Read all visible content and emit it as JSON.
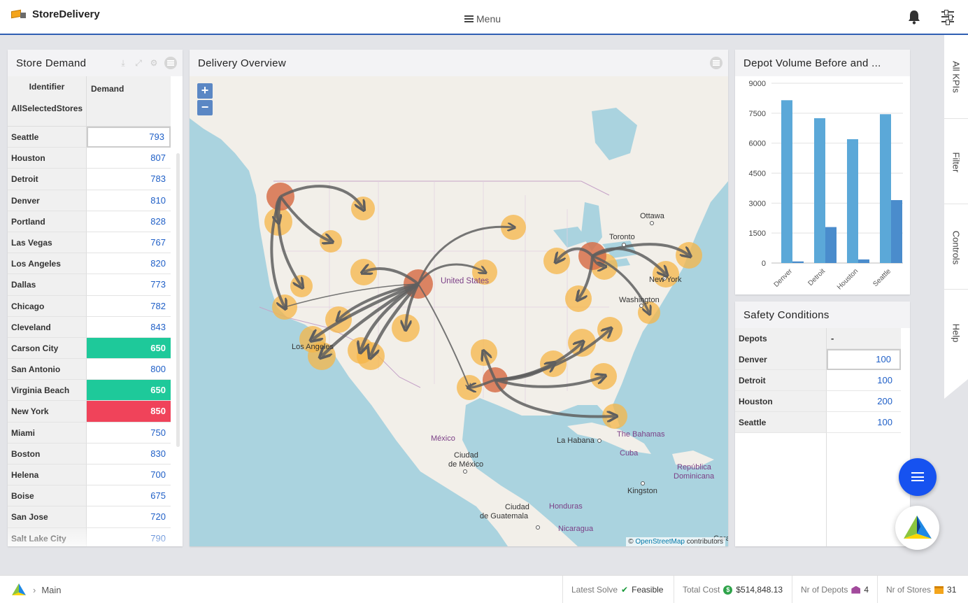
{
  "app": {
    "title": "StoreDelivery",
    "menu_label": "Menu"
  },
  "store_demand": {
    "title": "Store Demand",
    "header_identifier": "Identifier",
    "header_all": "AllSelectedStores",
    "header_demand": "Demand",
    "rows": [
      {
        "store": "Seattle",
        "demand": "793"
      },
      {
        "store": "Houston",
        "demand": "807"
      },
      {
        "store": "Detroit",
        "demand": "783"
      },
      {
        "store": "Denver",
        "demand": "810"
      },
      {
        "store": "Portland",
        "demand": "828"
      },
      {
        "store": "Las Vegas",
        "demand": "767"
      },
      {
        "store": "Los Angeles",
        "demand": "820"
      },
      {
        "store": "Dallas",
        "demand": "773"
      },
      {
        "store": "Chicago",
        "demand": "782"
      },
      {
        "store": "Cleveland",
        "demand": "843"
      },
      {
        "store": "Carson City",
        "demand": "650"
      },
      {
        "store": "San Antonio",
        "demand": "800"
      },
      {
        "store": "Virginia Beach",
        "demand": "650"
      },
      {
        "store": "New York",
        "demand": "850"
      },
      {
        "store": "Miami",
        "demand": "750"
      },
      {
        "store": "Boston",
        "demand": "830"
      },
      {
        "store": "Helena",
        "demand": "700"
      },
      {
        "store": "Boise",
        "demand": "675"
      },
      {
        "store": "San Jose",
        "demand": "720"
      },
      {
        "store": "Salt Lake City",
        "demand": "790"
      }
    ]
  },
  "delivery_overview": {
    "title": "Delivery Overview",
    "zoom_in": "+",
    "zoom_out": "−",
    "labels": {
      "ottawa": "Ottawa",
      "toronto": "Toronto",
      "united_states": "United States",
      "new_york": "New York",
      "washington": "Washington",
      "los_angeles": "Los Angeles",
      "mexico": "México",
      "ciudad_mexico_1": "Ciudad",
      "ciudad_mexico_2": "de México",
      "la_habana": "La Habana",
      "bahamas": "The Bahamas",
      "cuba": "Cuba",
      "rep_dom_1": "República",
      "rep_dom_2": "Dominicana",
      "kingston": "Kingston",
      "ciudad_guatemala_1": "Ciudad",
      "ciudad_guatemala_2": "de Guatemala",
      "honduras": "Honduras",
      "nicaragua": "Nicaragua",
      "caracas": "Carac"
    },
    "attribution_prefix": "©",
    "attribution_link": "OpenStreetMap",
    "attribution_suffix": "contributors"
  },
  "depot_volume": {
    "title": "Depot Volume Before and ...",
    "y_ticks": [
      "9000",
      "7500",
      "6000",
      "4500",
      "3000",
      "1500",
      "0"
    ]
  },
  "chart_data": {
    "type": "bar",
    "title": "Depot Volume Before and ...",
    "categories": [
      "Denver",
      "Detroit",
      "Houston",
      "Seattle"
    ],
    "series": [
      {
        "values": [
          8150,
          7250,
          6200,
          7450
        ],
        "color": "#5ba8d8"
      },
      {
        "values": [
          80,
          1800,
          180,
          3150
        ],
        "color": "#4a8ccc"
      }
    ],
    "ylim": [
      0,
      9000
    ],
    "yticks": [
      0,
      1500,
      3000,
      4500,
      6000,
      7500,
      9000
    ],
    "grid": true
  },
  "safety_conditions": {
    "title": "Safety Conditions",
    "header_depots": "Depots",
    "header_value": "-",
    "rows": [
      {
        "depot": "Denver",
        "value": "100"
      },
      {
        "depot": "Detroit",
        "value": "100"
      },
      {
        "depot": "Houston",
        "value": "200"
      },
      {
        "depot": "Seattle",
        "value": "100"
      }
    ]
  },
  "side_tabs": [
    "All KPIs",
    "Filter",
    "Controls",
    "Help"
  ],
  "footer": {
    "breadcrumb": "Main",
    "latest_solve_label": "Latest Solve",
    "latest_solve_value": "Feasible",
    "total_cost_label": "Total Cost",
    "total_cost_value": "$514,848.13",
    "depots_label": "Nr of Depots",
    "depots_value": "4",
    "stores_label": "Nr of Stores",
    "stores_value": "31"
  },
  "colors": {
    "accent": "#2f5fb3",
    "fab": "#1652f0",
    "cell_green": "#1ec99a",
    "cell_red": "#f0435a",
    "store_marker": "#f6b547",
    "depot_marker": "#d7704a"
  }
}
